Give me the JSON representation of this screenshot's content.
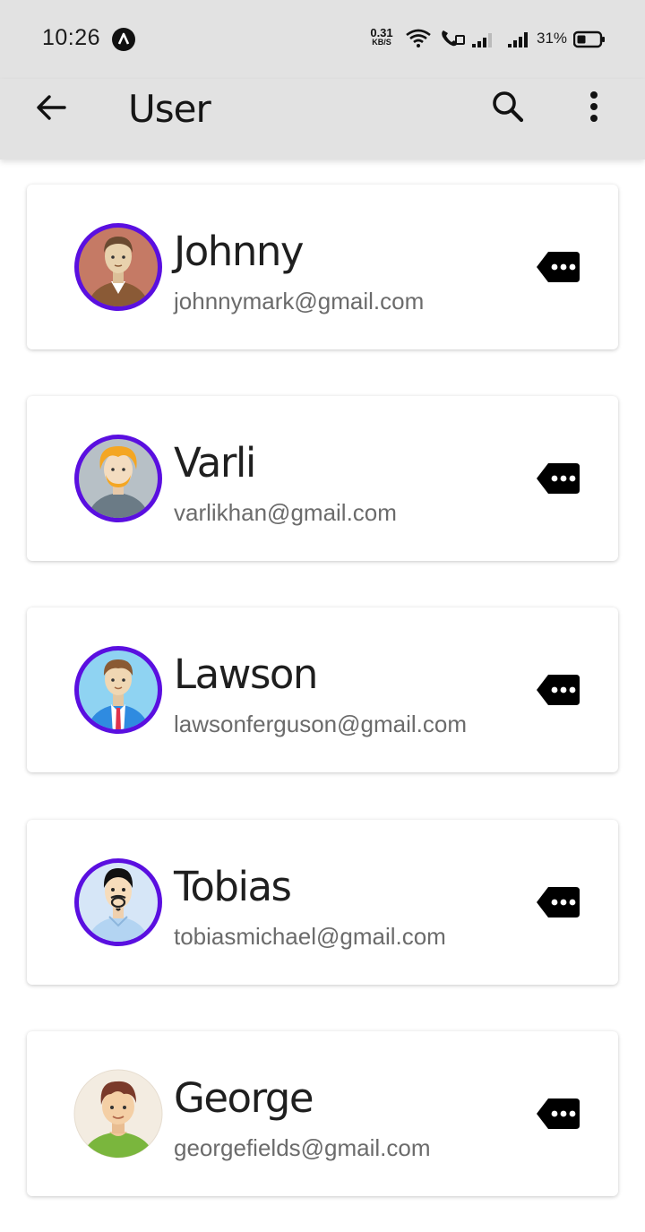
{
  "status_bar": {
    "time": "10:26",
    "speed_value": "0.31",
    "speed_unit": "KB/S",
    "battery_percent": "31%",
    "icons": [
      "notification-icon",
      "wifi-icon",
      "volte-call-icon",
      "signal-icon",
      "signal-icon",
      "battery-icon"
    ]
  },
  "app_bar": {
    "title": "User",
    "icons": [
      "back-arrow-icon",
      "search-icon",
      "more-vert-icon"
    ]
  },
  "users": [
    {
      "name": "Johnny",
      "email": "johnnymark@gmail.com",
      "ring_color": "#5a0fe0"
    },
    {
      "name": "Varli",
      "email": "varlikhan@gmail.com",
      "ring_color": "#5a0fe0"
    },
    {
      "name": "Lawson",
      "email": "lawsonferguson@gmail.com",
      "ring_color": "#5a0fe0"
    },
    {
      "name": "Tobias",
      "email": "tobiasmichael@gmail.com",
      "ring_color": "#5a0fe0"
    },
    {
      "name": "George",
      "email": "georgefields@gmail.com",
      "ring_color": "none"
    }
  ],
  "colors": {
    "app_bar_bg": "#e2e2e2",
    "avatar_ring": "#5a0fe0",
    "name_text": "#1f1f1f",
    "email_text": "#6b6b6b"
  }
}
